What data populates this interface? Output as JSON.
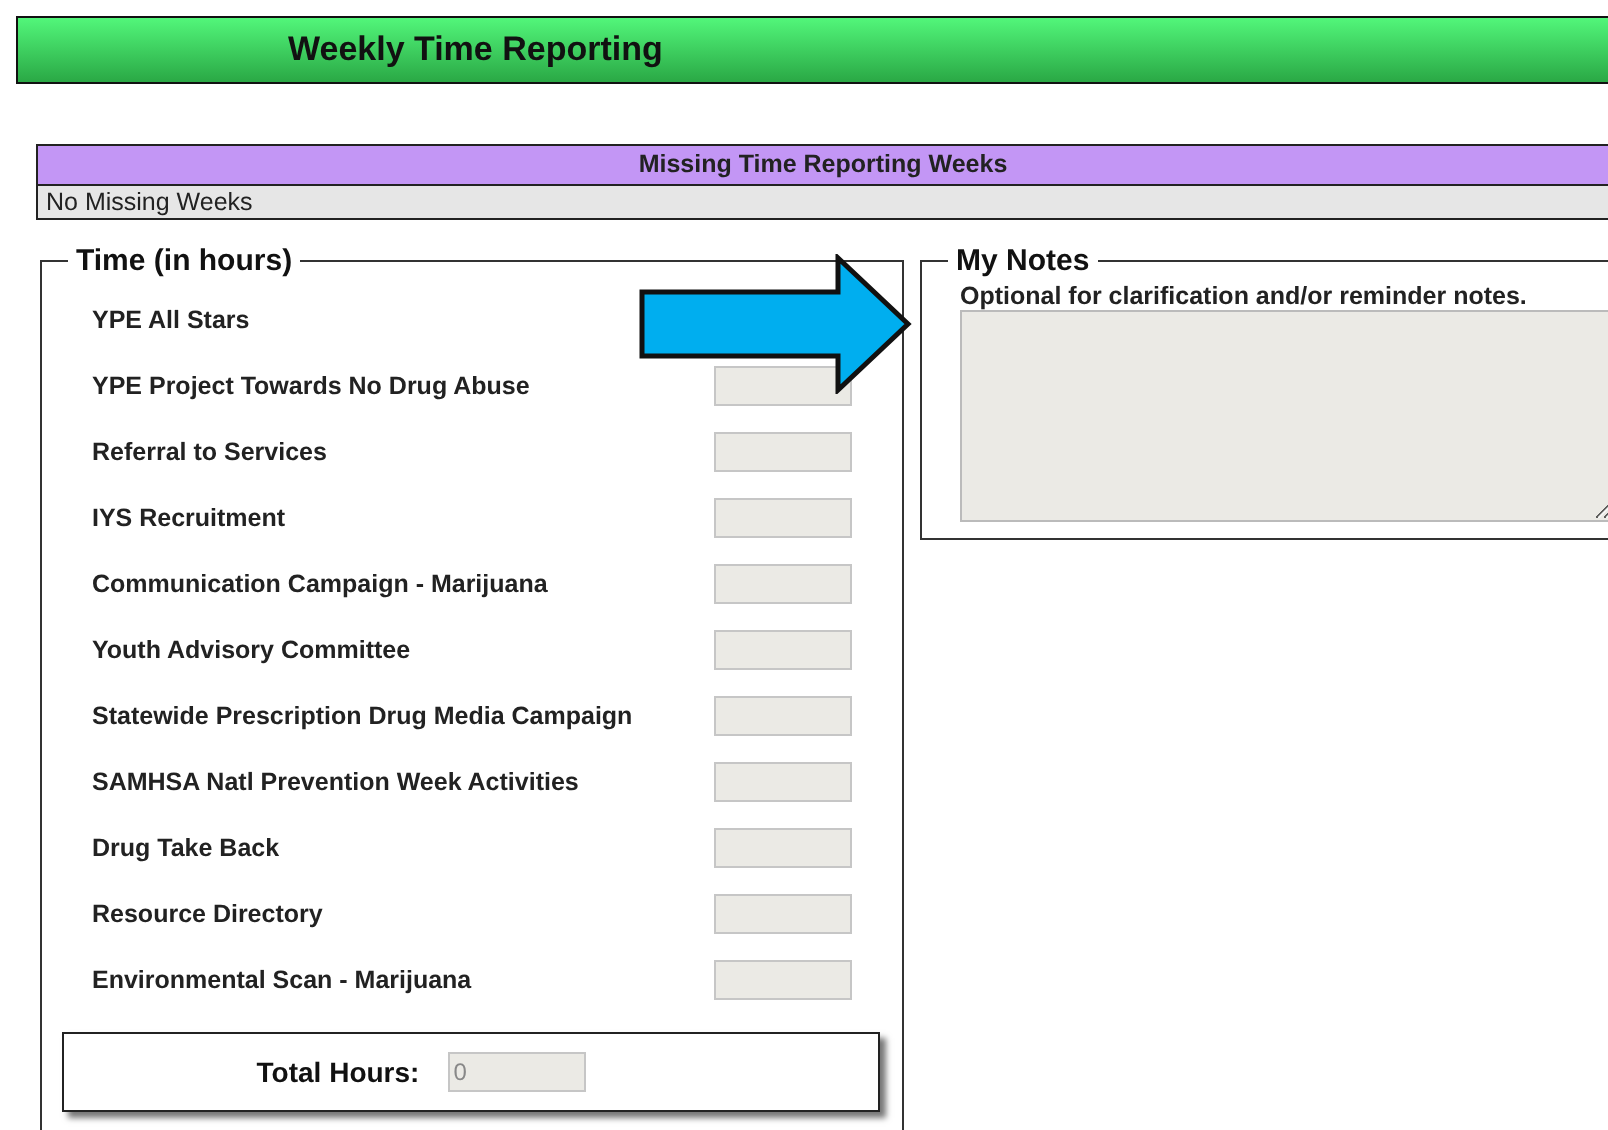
{
  "header": {
    "title": "Weekly Time Reporting"
  },
  "missing_weeks": {
    "heading": "Missing Time Reporting Weeks",
    "message": "No Missing Weeks"
  },
  "time": {
    "legend": "Time (in hours)",
    "items": [
      {
        "label": "YPE All Stars",
        "kind": "label"
      },
      {
        "label": "YPE Project Towards No Drug Abuse",
        "kind": "input"
      },
      {
        "label": "Referral to Services",
        "kind": "input"
      },
      {
        "label": "IYS Recruitment",
        "kind": "input"
      },
      {
        "label": "Communication Campaign - Marijuana",
        "kind": "input"
      },
      {
        "label": "Youth Advisory Committee",
        "kind": "input"
      },
      {
        "label": "Statewide Prescription Drug Media Campaign",
        "kind": "input"
      },
      {
        "label": "SAMHSA Natl Prevention Week Activities",
        "kind": "input"
      },
      {
        "label": "Drug Take Back",
        "kind": "input"
      },
      {
        "label": "Resource Directory",
        "kind": "input"
      },
      {
        "label": "Environmental Scan - Marijuana",
        "kind": "input"
      }
    ],
    "total": {
      "label": "Total Hours:",
      "value": "0"
    }
  },
  "notes": {
    "legend": "My Notes",
    "hint": "Optional for clarification and/or reminder notes."
  }
}
